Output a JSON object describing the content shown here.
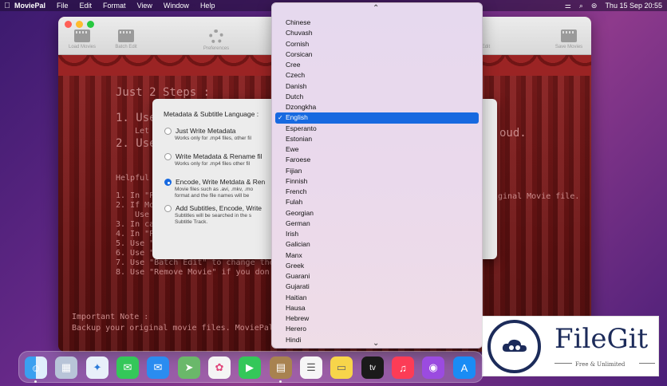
{
  "menubar": {
    "app_name": "MoviePal",
    "items": [
      "File",
      "Edit",
      "Format",
      "View",
      "Window",
      "Help"
    ],
    "datetime": "Thu 15 Sep  20:55"
  },
  "toolbar": {
    "items": [
      "Load Movies",
      "Batch Edit",
      "Preferences",
      "Save Movies"
    ],
    "partial_item": "Edit"
  },
  "stage": {
    "steps_title": "Just 2 Steps :",
    "step1": "1. Use",
    "step1b": "Let",
    "step2": "2. Use",
    "step_right": "oud.",
    "helpful": "Helpful H",
    "lines": [
      "1. In \"Pre",
      "2. If Movi",
      "Use",
      "3. In case",
      "4. In \"Pre",
      "5. Use \"Ed",
      "6. Use \"Cl",
      "7. Use \"Batch Edit\" to change the Gen",
      "8. Use \"Remove Movie\" if you don't wa"
    ],
    "right_line": "iginal Movie file.",
    "note_title": "Important Note :",
    "note_text": "Backup your original movie files. MoviePal a"
  },
  "dialog": {
    "header": "Metadata & Subtitle Language :",
    "options": [
      {
        "title": "Just Write Metadata",
        "sub": [
          "Works only for .mp4 files, other fil"
        ],
        "selected": false
      },
      {
        "title": "Write Metadata & Rename fil",
        "sub": [
          "Works only for .mp4 files other fil"
        ],
        "selected": false
      },
      {
        "title": "Encode, Write Metdata & Ren",
        "sub": [
          "Movie files such as .avi, .mkv, .mo",
          "format and the file names will be"
        ],
        "selected": true
      },
      {
        "title": "Add Subtitles, Encode, Write",
        "sub": [
          "Subtitles will be searched in the s",
          "Subtitle Track."
        ],
        "selected": false
      }
    ]
  },
  "language_menu": {
    "scroll_up": "⌃",
    "scroll_down": "⌄",
    "selected": "English",
    "items": [
      "Chinese",
      "Chuvash",
      "Cornish",
      "Corsican",
      "Cree",
      "Czech",
      "Danish",
      "Dutch",
      "Dzongkha",
      "English",
      "Esperanto",
      "Estonian",
      "Ewe",
      "Faroese",
      "Fijian",
      "Finnish",
      "French",
      "Fulah",
      "Georgian",
      "German",
      "Irish",
      "Galician",
      "Manx",
      "Greek",
      "Guarani",
      "Gujarati",
      "Haitian",
      "Hausa",
      "Hebrew",
      "Herero",
      "Hindi"
    ]
  },
  "badge": {
    "brand": "FileGit",
    "tagline": "Free & Unlimited"
  },
  "dock": {
    "apps": [
      "finder-icon",
      "launchpad-icon",
      "safari-icon",
      "messages-icon",
      "mail-icon",
      "maps-icon",
      "photos-icon",
      "facetime-icon",
      "moviepal-icon",
      "reminders-icon",
      "notes-icon",
      "appletv-icon",
      "music-icon",
      "podcasts-icon",
      "appstore-icon"
    ],
    "tv_label": "tv"
  },
  "colors": {
    "accent": "#1769e0",
    "curtain": "#7a1a1a"
  }
}
